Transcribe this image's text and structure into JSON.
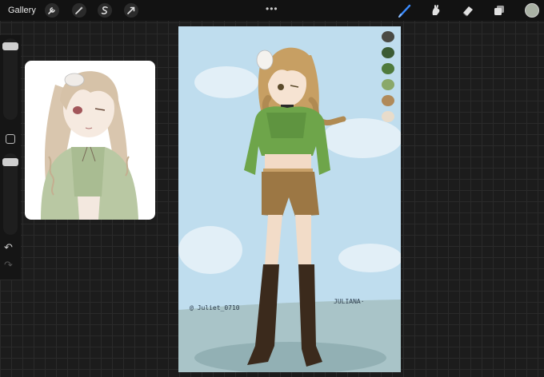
{
  "toolbar": {
    "gallery_label": "Gallery",
    "left_tools": [
      "wrench-icon",
      "magic-wand-icon",
      "selection-s-icon",
      "transform-arrow-icon"
    ],
    "more_label": "•••",
    "right_tools": [
      "brush-icon",
      "smudge-icon",
      "eraser-icon",
      "layers-icon"
    ],
    "current_color": "#a9b1a4"
  },
  "sidebar": {
    "undo_glyph": "↶",
    "redo_glyph": "↷"
  },
  "canvas": {
    "palette": [
      "#4a4a44",
      "#3b5b34",
      "#4f7a3c",
      "#8aa86a",
      "#b08a5a",
      "#e8dccb"
    ],
    "signature": "@ Juliet_0710",
    "name_label": "JULIANA·"
  }
}
